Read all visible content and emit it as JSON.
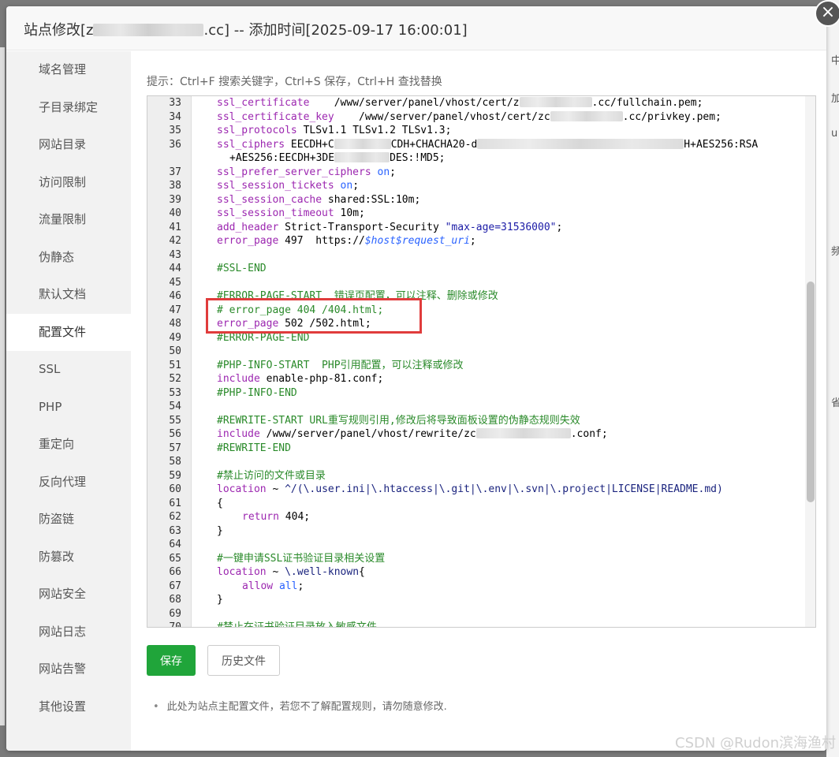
{
  "dialog": {
    "title_prefix": "站点修改[z",
    "title_suffix": ".cc] -- 添加时间[2025-09-17 16:00:01]"
  },
  "sidebar": {
    "items": [
      {
        "label": "域名管理"
      },
      {
        "label": "子目录绑定"
      },
      {
        "label": "网站目录"
      },
      {
        "label": "访问限制"
      },
      {
        "label": "流量限制"
      },
      {
        "label": "伪静态"
      },
      {
        "label": "默认文档"
      },
      {
        "label": "配置文件",
        "active": true
      },
      {
        "label": "SSL"
      },
      {
        "label": "PHP"
      },
      {
        "label": "重定向"
      },
      {
        "label": "反向代理"
      },
      {
        "label": "防盗链"
      },
      {
        "label": "防篡改"
      },
      {
        "label": "网站安全"
      },
      {
        "label": "网站日志"
      },
      {
        "label": "网站告警"
      },
      {
        "label": "其他设置"
      }
    ]
  },
  "editor": {
    "tip": "提示：Ctrl+F 搜索关键字，Ctrl+S 保存，Ctrl+H 查找替换",
    "lines": {
      "l33": {
        "n": "33",
        "k": "ssl_certificate",
        "a": "    /www/server/panel/vhost/cert/z",
        "b": ".cc/fullchain.pem;"
      },
      "l34": {
        "n": "34",
        "k": "ssl_certificate_key",
        "a": "    /www/server/panel/vhost/cert/zc",
        "b": ".cc/privkey.pem;"
      },
      "l35": {
        "n": "35",
        "k": "ssl_protocols",
        "a": " TLSv1.1 TLSv1.2 TLSv1.3;"
      },
      "l36": {
        "n": "36",
        "k": "ssl_ciphers",
        "a": " EECDH+C",
        "b": "CDH+CHACHA20-d",
        "c": "H+AES256:RSA",
        "d": "+AES256:EECDH+3DE",
        "e": "DES:!MD5;"
      },
      "l37": {
        "n": "37",
        "k": "ssl_prefer_server_ciphers",
        "v": "on",
        "e": ";"
      },
      "l38": {
        "n": "38",
        "k": "ssl_session_tickets",
        "v": "on",
        "e": ";"
      },
      "l39": {
        "n": "39",
        "k": "ssl_session_cache",
        "a": " shared:SSL:10m;"
      },
      "l40": {
        "n": "40",
        "k": "ssl_session_timeout",
        "a": " 10m;"
      },
      "l41": {
        "n": "41",
        "k": "add_header",
        "a": " Strict-Transport-Security ",
        "s": "\"max-age=31536000\"",
        "e": ";"
      },
      "l42": {
        "n": "42",
        "k": "error_page",
        "a": " 497  https://",
        "v": "$host$request_uri",
        "e": ";"
      },
      "l43": {
        "n": "43"
      },
      "l44": {
        "n": "44",
        "c": "#SSL-END"
      },
      "l45": {
        "n": "45"
      },
      "l46": {
        "n": "46",
        "c": "#ERROR-PAGE-START  错误页配置，可以注释、删除或修改"
      },
      "l47": {
        "n": "47",
        "c": "# error_page 404 /404.html;"
      },
      "l48": {
        "n": "48",
        "k": "error_page",
        "a": " 502 /502.html;"
      },
      "l49": {
        "n": "49",
        "c": "#ERROR-PAGE-END"
      },
      "l50": {
        "n": "50"
      },
      "l51": {
        "n": "51",
        "c": "#PHP-INFO-START  PHP引用配置，可以注释或修改"
      },
      "l52": {
        "n": "52",
        "k": "include",
        "a": " enable-php-81.conf;"
      },
      "l53": {
        "n": "53",
        "c": "#PHP-INFO-END"
      },
      "l54": {
        "n": "54"
      },
      "l55": {
        "n": "55",
        "c": "#REWRITE-START URL重写规则引用,修改后将导致面板设置的伪静态规则失效"
      },
      "l56": {
        "n": "56",
        "k": "include",
        "a": " /www/server/panel/vhost/rewrite/zc",
        "b": ".conf;"
      },
      "l57": {
        "n": "57",
        "c": "#REWRITE-END"
      },
      "l58": {
        "n": "58"
      },
      "l59": {
        "n": "59",
        "c": "#禁止访问的文件或目录"
      },
      "l60": {
        "n": "60",
        "k": "location",
        "a": " ~ ",
        "lk": "^/(\\.user.ini|\\.htaccess|\\.git|\\.env|\\.svn|\\.project|LICENSE|README.md)"
      },
      "l61": {
        "n": "61",
        "a": "{"
      },
      "l62": {
        "n": "62",
        "k": "return",
        "a": " 404;"
      },
      "l63": {
        "n": "63",
        "a": "}"
      },
      "l64": {
        "n": "64"
      },
      "l65": {
        "n": "65",
        "c": "#一键申请SSL证书验证目录相关设置"
      },
      "l66": {
        "n": "66",
        "k": "location",
        "a": " ~ ",
        "lk": "\\.well-known",
        "e": "{"
      },
      "l67": {
        "n": "67",
        "k": "allow",
        "v": "all",
        "e": ";"
      },
      "l68": {
        "n": "68",
        "a": "}"
      },
      "l69": {
        "n": "69"
      },
      "l70": {
        "n": "70",
        "c": "#禁止在证书验证目录放入敏感文件"
      }
    }
  },
  "buttons": {
    "save": "保存",
    "history": "历史文件"
  },
  "note": "此处为站点主配置文件，若您不了解配置规则，请勿随意修改.",
  "watermark": "CSDN @Rudon滨海渔村",
  "background": {
    "right_chars": [
      "中",
      "加",
      "u",
      "频",
      "省"
    ]
  },
  "colors": {
    "accent": "#20a53a",
    "highlight": "#e03c3c"
  }
}
